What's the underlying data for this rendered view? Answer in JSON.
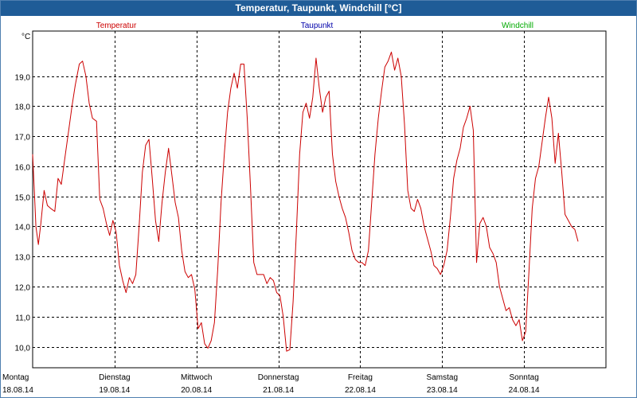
{
  "window": {
    "title": "Temperatur, Taupunkt, Windchill [°C]"
  },
  "colors": {
    "temperatur": "#cc0000",
    "taupunkt": "#0000aa",
    "windchill": "#00aa00"
  },
  "chart_data": {
    "type": "line",
    "title": "Temperatur, Taupunkt, Windchill [°C]",
    "ylabel": "°C",
    "ylim": [
      9.3,
      20.5
    ],
    "yticks": [
      "10,0",
      "11,0",
      "12,0",
      "13,0",
      "14,0",
      "15,0",
      "16,0",
      "17,0",
      "18,0",
      "19,0"
    ],
    "ytick_values": [
      10,
      11,
      12,
      13,
      14,
      15,
      16,
      17,
      18,
      19
    ],
    "xlim": [
      0,
      7
    ],
    "grid": true,
    "legend": [
      {
        "name": "Temperatur",
        "color": "#cc0000"
      },
      {
        "name": "Taupunkt",
        "color": "#0000aa"
      },
      {
        "name": "Windchill",
        "color": "#00aa00"
      }
    ],
    "x_days": [
      {
        "day": "Montag",
        "date": "18.08.14"
      },
      {
        "day": "Dienstag",
        "date": "19.08.14"
      },
      {
        "day": "Mittwoch",
        "date": "20.08.14"
      },
      {
        "day": "Donnerstag",
        "date": "21.08.14"
      },
      {
        "day": "Freitag",
        "date": "22.08.14"
      },
      {
        "day": "Samstag",
        "date": "23.08.14"
      },
      {
        "day": "Sonntag",
        "date": "24.08.14"
      }
    ],
    "series": [
      {
        "name": "Temperatur",
        "color": "#cc0000",
        "points": [
          [
            0.0,
            16.4
          ],
          [
            0.02,
            15.2
          ],
          [
            0.04,
            14.0
          ],
          [
            0.07,
            13.4
          ],
          [
            0.1,
            14.1
          ],
          [
            0.14,
            15.2
          ],
          [
            0.18,
            14.7
          ],
          [
            0.22,
            14.6
          ],
          [
            0.27,
            14.5
          ],
          [
            0.31,
            15.6
          ],
          [
            0.35,
            15.4
          ],
          [
            0.4,
            16.4
          ],
          [
            0.44,
            17.2
          ],
          [
            0.48,
            18.0
          ],
          [
            0.52,
            18.7
          ],
          [
            0.57,
            19.4
          ],
          [
            0.61,
            19.5
          ],
          [
            0.65,
            19.0
          ],
          [
            0.69,
            18.1
          ],
          [
            0.73,
            17.6
          ],
          [
            0.78,
            17.5
          ],
          [
            0.82,
            14.9
          ],
          [
            0.86,
            14.6
          ],
          [
            0.9,
            14.1
          ],
          [
            0.94,
            13.7
          ],
          [
            0.98,
            14.2
          ],
          [
            1.02,
            13.8
          ],
          [
            1.06,
            12.7
          ],
          [
            1.1,
            12.2
          ],
          [
            1.14,
            11.8
          ],
          [
            1.18,
            12.3
          ],
          [
            1.22,
            12.1
          ],
          [
            1.26,
            12.4
          ],
          [
            1.3,
            14.0
          ],
          [
            1.34,
            15.8
          ],
          [
            1.38,
            16.7
          ],
          [
            1.42,
            16.9
          ],
          [
            1.46,
            15.6
          ],
          [
            1.5,
            14.2
          ],
          [
            1.54,
            13.5
          ],
          [
            1.58,
            14.8
          ],
          [
            1.62,
            15.8
          ],
          [
            1.66,
            16.6
          ],
          [
            1.7,
            15.7
          ],
          [
            1.74,
            14.8
          ],
          [
            1.78,
            14.3
          ],
          [
            1.82,
            13.2
          ],
          [
            1.86,
            12.5
          ],
          [
            1.9,
            12.3
          ],
          [
            1.94,
            12.4
          ],
          [
            1.98,
            11.9
          ],
          [
            2.02,
            10.6
          ],
          [
            2.06,
            10.8
          ],
          [
            2.1,
            10.1
          ],
          [
            2.14,
            9.95
          ],
          [
            2.18,
            10.2
          ],
          [
            2.22,
            10.8
          ],
          [
            2.26,
            12.6
          ],
          [
            2.3,
            14.8
          ],
          [
            2.34,
            16.4
          ],
          [
            2.38,
            17.8
          ],
          [
            2.42,
            18.6
          ],
          [
            2.46,
            19.1
          ],
          [
            2.5,
            18.6
          ],
          [
            2.54,
            19.4
          ],
          [
            2.58,
            19.4
          ],
          [
            2.62,
            17.6
          ],
          [
            2.66,
            15.3
          ],
          [
            2.7,
            12.8
          ],
          [
            2.74,
            12.4
          ],
          [
            2.78,
            12.4
          ],
          [
            2.82,
            12.4
          ],
          [
            2.86,
            12.1
          ],
          [
            2.9,
            12.3
          ],
          [
            2.94,
            12.2
          ],
          [
            2.98,
            11.8
          ],
          [
            3.02,
            11.7
          ],
          [
            3.06,
            11.0
          ],
          [
            3.1,
            9.85
          ],
          [
            3.14,
            9.9
          ],
          [
            3.18,
            11.5
          ],
          [
            3.22,
            13.8
          ],
          [
            3.26,
            16.4
          ],
          [
            3.3,
            17.8
          ],
          [
            3.34,
            18.1
          ],
          [
            3.38,
            17.6
          ],
          [
            3.42,
            18.3
          ],
          [
            3.46,
            19.6
          ],
          [
            3.5,
            18.6
          ],
          [
            3.54,
            17.8
          ],
          [
            3.58,
            18.3
          ],
          [
            3.62,
            18.5
          ],
          [
            3.66,
            16.4
          ],
          [
            3.7,
            15.5
          ],
          [
            3.74,
            15.0
          ],
          [
            3.78,
            14.6
          ],
          [
            3.82,
            14.3
          ],
          [
            3.86,
            13.8
          ],
          [
            3.9,
            13.2
          ],
          [
            3.94,
            12.9
          ],
          [
            3.98,
            12.8
          ],
          [
            4.02,
            12.8
          ],
          [
            4.06,
            12.7
          ],
          [
            4.1,
            13.2
          ],
          [
            4.14,
            14.8
          ],
          [
            4.18,
            16.4
          ],
          [
            4.22,
            17.6
          ],
          [
            4.26,
            18.5
          ],
          [
            4.3,
            19.3
          ],
          [
            4.34,
            19.5
          ],
          [
            4.38,
            19.8
          ],
          [
            4.42,
            19.2
          ],
          [
            4.46,
            19.6
          ],
          [
            4.5,
            19.0
          ],
          [
            4.54,
            17.4
          ],
          [
            4.58,
            15.2
          ],
          [
            4.62,
            14.6
          ],
          [
            4.66,
            14.5
          ],
          [
            4.7,
            14.9
          ],
          [
            4.74,
            14.6
          ],
          [
            4.78,
            14.0
          ],
          [
            4.82,
            13.6
          ],
          [
            4.86,
            13.2
          ],
          [
            4.9,
            12.7
          ],
          [
            4.94,
            12.6
          ],
          [
            4.98,
            12.4
          ],
          [
            5.02,
            12.7
          ],
          [
            5.06,
            13.2
          ],
          [
            5.1,
            14.3
          ],
          [
            5.14,
            15.6
          ],
          [
            5.18,
            16.2
          ],
          [
            5.22,
            16.6
          ],
          [
            5.26,
            17.3
          ],
          [
            5.3,
            17.6
          ],
          [
            5.34,
            18.0
          ],
          [
            5.38,
            17.2
          ],
          [
            5.42,
            12.8
          ],
          [
            5.46,
            14.1
          ],
          [
            5.5,
            14.3
          ],
          [
            5.54,
            14.0
          ],
          [
            5.58,
            13.3
          ],
          [
            5.62,
            13.1
          ],
          [
            5.66,
            12.8
          ],
          [
            5.7,
            12.0
          ],
          [
            5.74,
            11.6
          ],
          [
            5.78,
            11.2
          ],
          [
            5.82,
            11.3
          ],
          [
            5.86,
            10.9
          ],
          [
            5.9,
            10.7
          ],
          [
            5.94,
            10.9
          ],
          [
            5.98,
            10.2
          ],
          [
            6.02,
            10.5
          ],
          [
            6.06,
            12.5
          ],
          [
            6.1,
            14.6
          ],
          [
            6.14,
            15.6
          ],
          [
            6.18,
            16.0
          ],
          [
            6.22,
            16.8
          ],
          [
            6.26,
            17.6
          ],
          [
            6.3,
            18.3
          ],
          [
            6.34,
            17.6
          ],
          [
            6.38,
            16.1
          ],
          [
            6.42,
            17.1
          ],
          [
            6.46,
            15.8
          ],
          [
            6.5,
            14.4
          ],
          [
            6.54,
            14.2
          ],
          [
            6.58,
            14.0
          ],
          [
            6.62,
            13.9
          ],
          [
            6.66,
            13.5
          ]
        ]
      }
    ]
  }
}
